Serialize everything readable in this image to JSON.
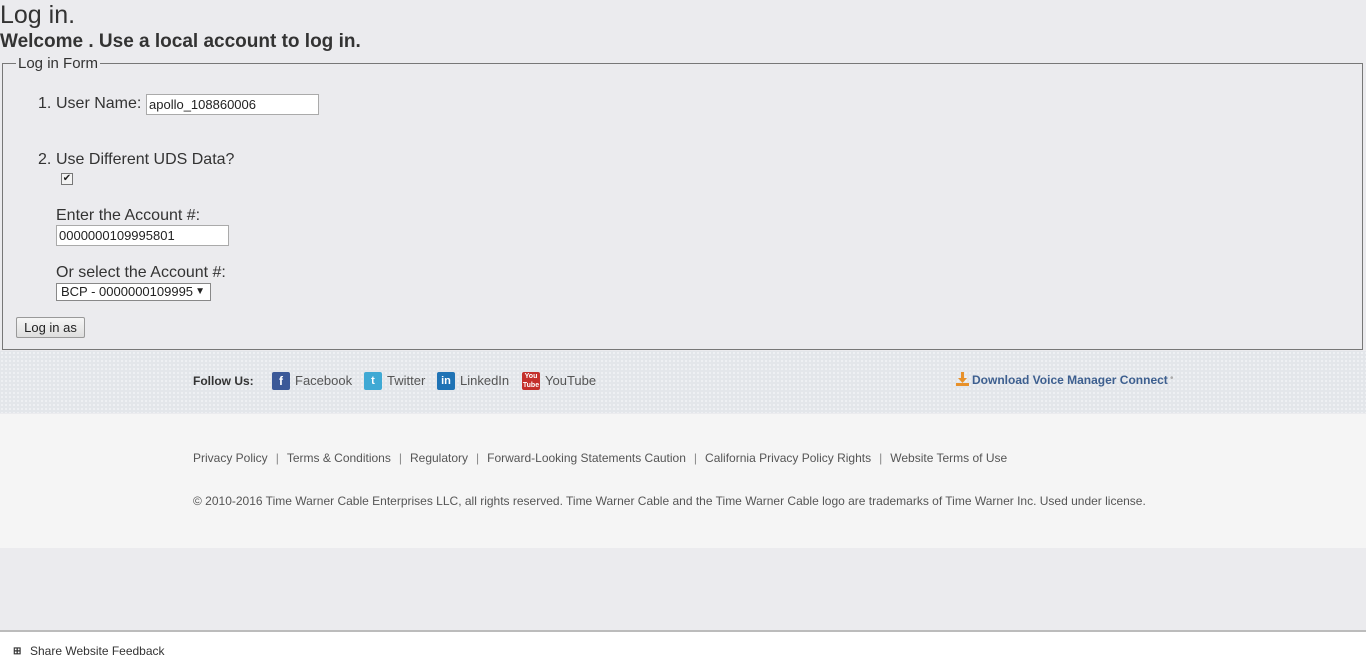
{
  "page": {
    "title": "Log in.",
    "subtitle": "Welcome . Use a local account to log in."
  },
  "form": {
    "legend": "Log in Form",
    "item1_number": "1.",
    "username_label": "User Name:",
    "username_value": "apollo_108860006",
    "item2_number": "2.",
    "uds_label": "Use Different UDS Data?",
    "uds_checked": true,
    "account_label": "Enter the Account #:",
    "account_value": "0000000109995801",
    "select_label": "Or select the Account #:",
    "select_value": "BCP - 0000000109995",
    "submit_label": "Log in as"
  },
  "social": {
    "follow_label": "Follow Us:",
    "links": [
      {
        "label": "Facebook",
        "icon": "facebook-icon",
        "color": "#3b5998"
      },
      {
        "label": "Twitter",
        "icon": "twitter-icon",
        "color": "#3fa9d4"
      },
      {
        "label": "LinkedIn",
        "icon": "linkedin-icon",
        "color": "#1f73b5"
      },
      {
        "label": "YouTube",
        "icon": "youtube-icon",
        "color": "#c4302b"
      }
    ],
    "download_label": "Download Voice Manager Connect",
    "download_color": "#e8912a"
  },
  "footer": {
    "links": [
      "Privacy Policy",
      "Terms & Conditions",
      "Regulatory",
      "Forward-Looking Statements Caution",
      "California Privacy Policy Rights",
      "Website Terms of Use"
    ],
    "separator": "|",
    "copyright": "© 2010-2016 Time Warner Cable Enterprises LLC, all rights reserved. Time Warner Cable and the Time Warner Cable logo are trademarks of Time Warner Inc. Used under license."
  },
  "feedback": {
    "label": "Share Website Feedback"
  }
}
